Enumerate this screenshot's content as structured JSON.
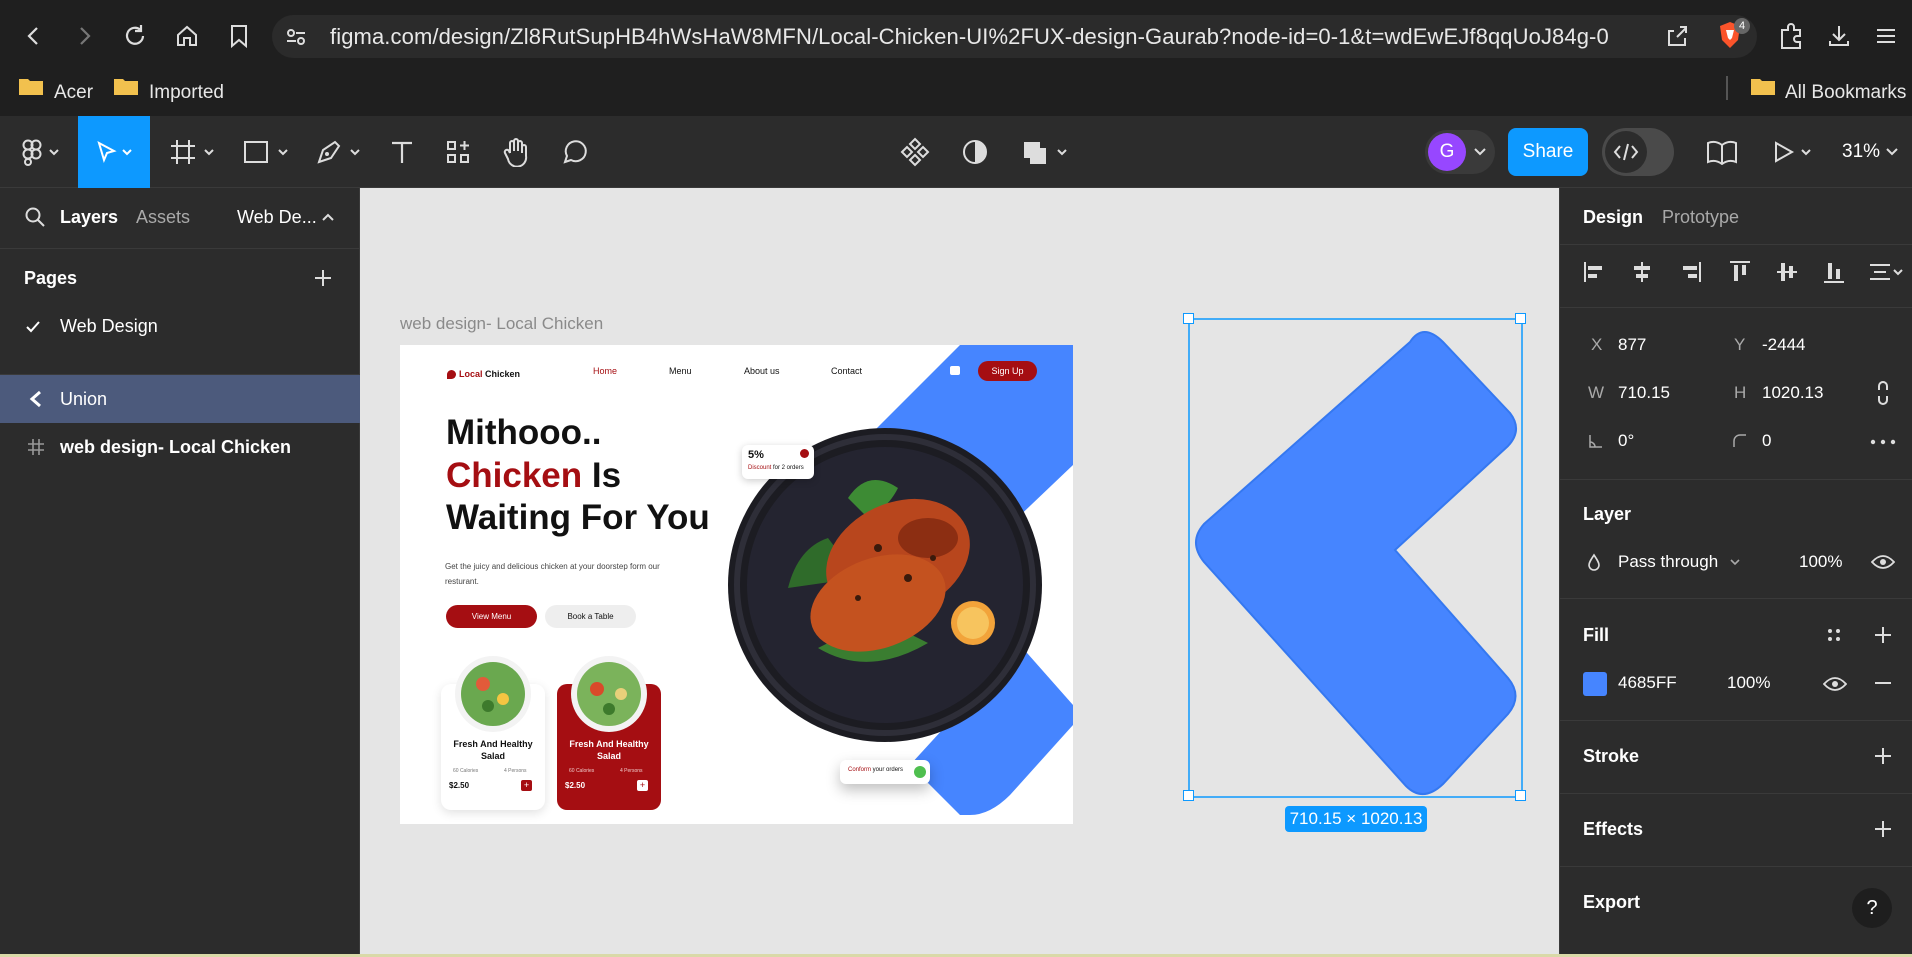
{
  "browser": {
    "url": "figma.com/design/Zl8RutSupHB4hWsHaW8MFN/Local-Chicken-UI%2FUX-design-Gaurab?node-id=0-1&t=wdEwEJf8qqUoJ84g-0",
    "extension_badge": "4",
    "bookmarks": [
      {
        "label": "Acer"
      },
      {
        "label": "Imported"
      }
    ],
    "all_bookmarks": "All Bookmarks"
  },
  "toolbar": {
    "avatar_letter": "G",
    "share_label": "Share",
    "zoom": "31%",
    "colors": {
      "accent": "#0d99ff",
      "avatar": "#9747ff"
    }
  },
  "left_panel": {
    "tabs": {
      "layers": "Layers",
      "assets": "Assets",
      "page_switch": "Web De..."
    },
    "pages_heading": "Pages",
    "pages": [
      {
        "label": "Web Design",
        "selected": true
      }
    ],
    "layers": [
      {
        "label": "Union",
        "icon": "union-icon",
        "selected": true
      },
      {
        "label": "web design- Local Chicken",
        "icon": "frame-icon",
        "selected": false
      }
    ]
  },
  "canvas": {
    "frame_label": "web design- Local Chicken",
    "selection_size": "710.15 × 1020.13",
    "union_fill": "#4685FF",
    "design": {
      "logo_text_a": "Local",
      "logo_text_b": "Chicken",
      "nav": [
        "Home",
        "Menu",
        "About us",
        "Contact"
      ],
      "signup": "Sign Up",
      "headline_1": "Mithooo..",
      "headline_2a": "Chicken",
      "headline_2b": " Is",
      "headline_3": "Waiting For You",
      "subtext": "Get the juicy and delicious chicken at your doorstep form our resturant.",
      "btn_view_menu": "View Menu",
      "btn_book_table": "Book a Table",
      "discount_pct": "5%",
      "discount_text_a": "Discount",
      "discount_text_b": " for 2 orders",
      "confirm_a": "Conform",
      "confirm_b": " your orders",
      "cards": [
        {
          "title": "Fresh And Healthy Salad",
          "calories": "60 Calories",
          "persons": "4 Persons",
          "price": "$2.50"
        },
        {
          "title": "Fresh And Healthy Salad",
          "calories": "60 Calories",
          "persons": "4 Persons",
          "price": "$2.50"
        }
      ],
      "colors": {
        "brand_red": "#a50e12",
        "blue": "#4685FF"
      }
    }
  },
  "right_panel": {
    "tabs": {
      "design": "Design",
      "prototype": "Prototype"
    },
    "x_label": "X",
    "x_value": "877",
    "y_label": "Y",
    "y_value": "-2444",
    "w_label": "W",
    "w_value": "710.15",
    "h_label": "H",
    "h_value": "1020.13",
    "rotation": "0°",
    "corner_radius": "0",
    "layer_heading": "Layer",
    "blend_mode": "Pass through",
    "layer_opacity": "100%",
    "fill_heading": "Fill",
    "fill_hex": "4685FF",
    "fill_opacity": "100%",
    "stroke_heading": "Stroke",
    "effects_heading": "Effects",
    "export_heading": "Export",
    "help": "?"
  }
}
